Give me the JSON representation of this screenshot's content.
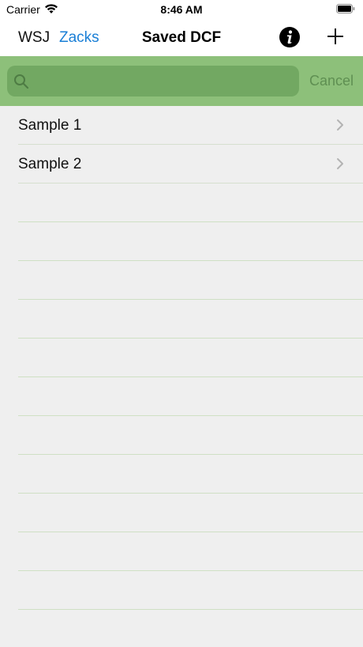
{
  "status": {
    "carrier": "Carrier",
    "time": "8:46 AM"
  },
  "nav": {
    "left_link_1": "WSJ",
    "left_link_2": "Zacks",
    "title": "Saved DCF",
    "info_icon": "info-icon",
    "add_icon": "plus-icon"
  },
  "search": {
    "value": "",
    "placeholder": "",
    "cancel_label": "Cancel"
  },
  "list": {
    "items": [
      {
        "label": "Sample 1"
      },
      {
        "label": "Sample 2"
      }
    ]
  },
  "colors": {
    "accent_blue": "#1a7fd6",
    "search_bar_green": "#8dc07a",
    "search_field_green": "#72a862",
    "cancel_green": "#5f8f52",
    "background": "#efefef"
  }
}
